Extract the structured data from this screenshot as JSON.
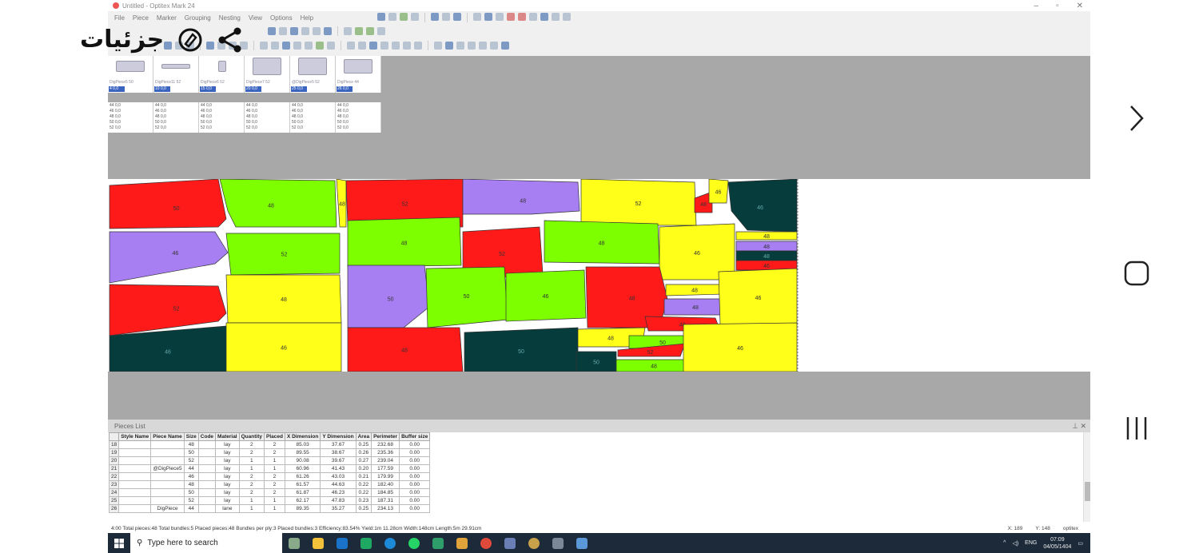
{
  "overlay": {
    "title": "جزئيات"
  },
  "window": {
    "title": "Untitled - Optitex Mark 24",
    "menu": [
      "File",
      "Piece",
      "Marker",
      "Grouping",
      "Nesting",
      "View",
      "Options",
      "Help"
    ]
  },
  "thumbnails": [
    {
      "name": "DigPiece5 50",
      "qty": "4 0,0"
    },
    {
      "name": "DigPiece11 52",
      "qty": "10 0,0"
    },
    {
      "name": "DigPiece6 52",
      "qty": "15 0,0"
    },
    {
      "name": "DigPiece7 52",
      "qty": "20 0,0"
    },
    {
      "name": "@DigPiece5 52",
      "qty": "25 0,0"
    },
    {
      "name": "DigPiece 44",
      "qty": "26 0,0"
    }
  ],
  "size_columns": [
    [
      "44 0,0",
      "46 0,0",
      "48 0,0",
      "50 0,0",
      "52 0,0"
    ],
    [
      "44 0,0",
      "46 0,0",
      "48 0,0",
      "50 0,0",
      "52 0,0"
    ],
    [
      "44 0,0",
      "46 0,0",
      "48 0,0",
      "50 0,0",
      "52 0,0"
    ],
    [
      "44 0,0",
      "46 0,0",
      "48 0,0",
      "50 0,0",
      "52 0,0"
    ],
    [
      "44 0,0",
      "46 0,0",
      "48 0,0",
      "50 0,0",
      "52 0,0"
    ],
    [
      "44 0,0",
      "46 0,0",
      "48 0,0",
      "50 0,0",
      "52 0,0"
    ]
  ],
  "marker_labels": [
    "50",
    "48",
    "48",
    "52",
    "48",
    "52",
    "48",
    "46",
    "46",
    "46",
    "52",
    "48",
    "52",
    "48",
    "46",
    "48",
    "48",
    "48",
    "46",
    "52",
    "48",
    "50",
    "50",
    "46",
    "48",
    "48",
    "48",
    "46",
    "48",
    "46",
    "46",
    "48",
    "50",
    "48",
    "50",
    "52",
    "50",
    "48",
    "46"
  ],
  "colors": {
    "red": "#ff1a1a",
    "green": "#7dff00",
    "yellow": "#ffff1a",
    "purple": "#a77ff2",
    "dark": "#063c3c"
  },
  "pieces_list": {
    "title": "Pieces List",
    "columns": [
      "",
      "Style Name",
      "Piece Name",
      "Size",
      "Code",
      "Material",
      "Quantity",
      "Placed",
      "X Dimension",
      "Y Dimension",
      "Area",
      "Perimeter",
      "Buffer size"
    ],
    "rows": [
      [
        "18",
        "",
        "",
        "48",
        "",
        "lay",
        "2",
        "2",
        "85.03",
        "37.67",
        "0.25",
        "232.68",
        "0.00"
      ],
      [
        "19",
        "",
        "",
        "50",
        "",
        "lay",
        "2",
        "2",
        "89.55",
        "38.67",
        "0.26",
        "235.36",
        "0.00"
      ],
      [
        "20",
        "",
        "",
        "52",
        "",
        "lay",
        "1",
        "1",
        "90.08",
        "39.67",
        "0.27",
        "239.04",
        "0.00"
      ],
      [
        "21",
        "",
        "@DigPiece5",
        "44",
        "",
        "lay",
        "1",
        "1",
        "60.96",
        "41.43",
        "0.20",
        "177.59",
        "0.00"
      ],
      [
        "22",
        "",
        "",
        "46",
        "",
        "lay",
        "2",
        "2",
        "61.26",
        "43.03",
        "0.21",
        "179.99",
        "0.00"
      ],
      [
        "23",
        "",
        "",
        "48",
        "",
        "lay",
        "2",
        "2",
        "61.57",
        "44.63",
        "0.22",
        "182.40",
        "0.00"
      ],
      [
        "24",
        "",
        "",
        "50",
        "",
        "lay",
        "2",
        "2",
        "61.87",
        "46.23",
        "0.22",
        "184.85",
        "0.00"
      ],
      [
        "25",
        "",
        "",
        "52",
        "",
        "lay",
        "1",
        "1",
        "62.17",
        "47.83",
        "0.23",
        "187.31",
        "0.00"
      ],
      [
        "26",
        "",
        "DigPiece",
        "44",
        "",
        "lane",
        "1",
        "1",
        "89.35",
        "35.27",
        "0.25",
        "234.13",
        "0.00"
      ]
    ]
  },
  "status": {
    "text": "4:00  Total pieces:48  Total bundles:5  Placed pieces:48  Bundles per ply:3  Placed bundles:3  Efficiency:83.54%  Yield:1m 11.28cm  Width:148cm  Length:5m 29.91cm",
    "x": "X: 189",
    "y": "Y: 148",
    "brand": "optitex"
  },
  "taskbar": {
    "search_placeholder": "Type here to search",
    "lang": "ENG",
    "time": "07:09",
    "date": "04/05/1404"
  }
}
